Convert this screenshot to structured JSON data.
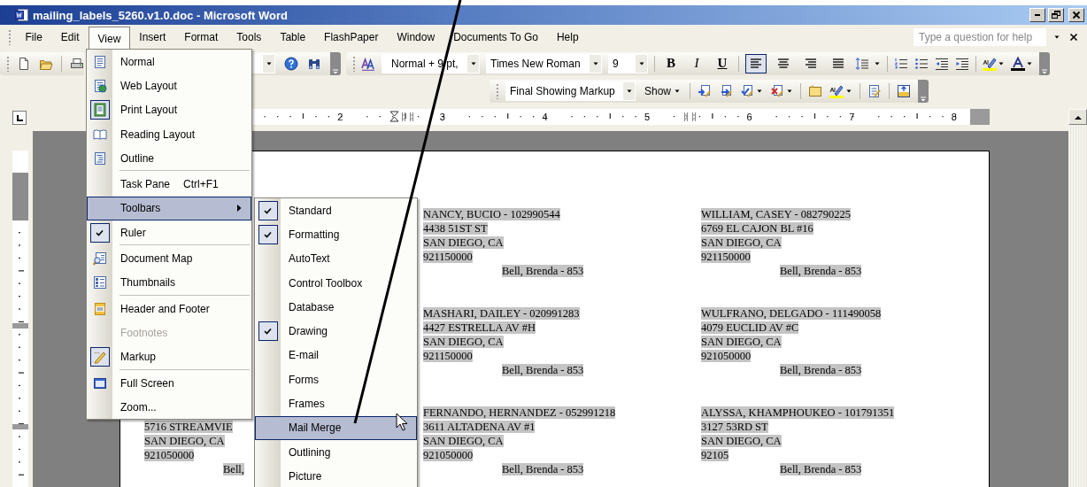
{
  "window": {
    "title": "mailing_labels_5260.v1.0.doc - Microsoft Word"
  },
  "menu_bar": {
    "items": [
      {
        "label": "File",
        "selected": false
      },
      {
        "label": "Edit",
        "selected": false
      },
      {
        "label": "View",
        "selected": true
      },
      {
        "label": "Insert",
        "selected": false
      },
      {
        "label": "Format",
        "selected": false
      },
      {
        "label": "Tools",
        "selected": false
      },
      {
        "label": "Table",
        "selected": false
      },
      {
        "label": "FlashPaper",
        "selected": false
      },
      {
        "label": "Window",
        "selected": false
      },
      {
        "label": "Documents To Go",
        "selected": false
      },
      {
        "label": "Help",
        "selected": false
      }
    ],
    "help_field": {
      "placeholder": "Type a question for help"
    }
  },
  "formatting_toolbar": {
    "style": "Normal + 9 pt,",
    "font": "Times New Roman",
    "size": "9",
    "text_style_buttons": [
      {
        "label": "B"
      },
      {
        "label": "I"
      },
      {
        "label": "U"
      }
    ],
    "alignment_buttons": [
      {
        "selected": true
      },
      {
        "selected": false
      },
      {
        "selected": false
      },
      {
        "selected": false
      }
    ]
  },
  "reviewing_toolbar": {
    "display": "Final Showing Markup",
    "show_button": "Show"
  },
  "ruler": {
    "numbers": [
      "2",
      "3",
      "4",
      "5",
      "6",
      "7",
      "8"
    ]
  },
  "view_menu": {
    "items": [
      {
        "label": "Normal",
        "checked": false,
        "selected": false,
        "disabled": false,
        "submenu": false,
        "separator_before": false
      },
      {
        "label": "Web Layout",
        "checked": false,
        "selected": false,
        "disabled": false,
        "submenu": false,
        "separator_before": false
      },
      {
        "label": "Print Layout",
        "checked": true,
        "selected": false,
        "disabled": false,
        "submenu": false,
        "separator_before": false
      },
      {
        "label": "Reading Layout",
        "checked": false,
        "selected": false,
        "disabled": false,
        "submenu": false,
        "separator_before": false
      },
      {
        "label": "Outline",
        "checked": false,
        "selected": false,
        "disabled": false,
        "submenu": false,
        "separator_before": false
      },
      {
        "label": "Task Pane",
        "shortcut": "Ctrl+F1",
        "checked": false,
        "selected": false,
        "disabled": false,
        "submenu": false,
        "separator_before": true
      },
      {
        "label": "Toolbars",
        "checked": false,
        "selected": true,
        "disabled": false,
        "submenu": true,
        "separator_before": false
      },
      {
        "label": "Ruler",
        "checked": true,
        "selected": false,
        "disabled": false,
        "submenu": false,
        "separator_before": false
      },
      {
        "label": "Document Map",
        "checked": false,
        "selected": false,
        "disabled": false,
        "submenu": false,
        "separator_before": true
      },
      {
        "label": "Thumbnails",
        "checked": false,
        "selected": false,
        "disabled": false,
        "submenu": false,
        "separator_before": false
      },
      {
        "label": "Header and Footer",
        "checked": false,
        "selected": false,
        "disabled": false,
        "submenu": false,
        "separator_before": true
      },
      {
        "label": "Footnotes",
        "checked": false,
        "selected": false,
        "disabled": true,
        "submenu": false,
        "separator_before": false
      },
      {
        "label": "Markup",
        "checked": true,
        "selected": false,
        "disabled": false,
        "submenu": false,
        "separator_before": false
      },
      {
        "label": "Full Screen",
        "checked": false,
        "selected": false,
        "disabled": false,
        "submenu": false,
        "separator_before": true
      },
      {
        "label": "Zoom...",
        "checked": false,
        "selected": false,
        "disabled": false,
        "submenu": false,
        "separator_before": false
      }
    ]
  },
  "toolbars_submenu": {
    "items": [
      {
        "label": "Standard",
        "checked": true,
        "selected": false
      },
      {
        "label": "Formatting",
        "checked": true,
        "selected": false
      },
      {
        "label": "AutoText",
        "checked": false,
        "selected": false
      },
      {
        "label": "Control Toolbox",
        "checked": false,
        "selected": false
      },
      {
        "label": "Database",
        "checked": false,
        "selected": false
      },
      {
        "label": "Drawing",
        "checked": true,
        "selected": false
      },
      {
        "label": "E-mail",
        "checked": false,
        "selected": false
      },
      {
        "label": "Forms",
        "checked": false,
        "selected": false
      },
      {
        "label": "Frames",
        "checked": false,
        "selected": false
      },
      {
        "label": "Mail Merge",
        "checked": false,
        "selected": true
      },
      {
        "label": "Outlining",
        "checked": false,
        "selected": false
      },
      {
        "label": "Picture",
        "checked": false,
        "selected": false
      }
    ]
  },
  "document": {
    "label_columns": [
      {
        "labels": [
          {
            "lines": [
              "5716 STREAMVIE",
              "SAN DIEGO, CA",
              "921050000"
            ],
            "footer": "Bell,"
          }
        ]
      },
      {
        "labels": [
          {
            "lines": [
              "NANCY, BUCIO - 102990544",
              "4438 51ST ST",
              "SAN DIEGO, CA",
              "921150000"
            ],
            "footer": "Bell, Brenda - 853"
          },
          {
            "lines": [
              "MASHARI, DAILEY - 020991283",
              "4427 ESTRELLA AV #H",
              "SAN DIEGO, CA",
              "921150000"
            ],
            "footer": "Bell, Brenda - 853"
          },
          {
            "lines": [
              "FERNANDO, HERNANDEZ - 052991218",
              "3611 ALTADENA AV #1",
              "SAN DIEGO, CA",
              "921050000"
            ],
            "footer": "Bell, Brenda - 853"
          }
        ]
      },
      {
        "labels": [
          {
            "lines": [
              "WILLIAM, CASEY - 082790225",
              "6769 EL CAJON BL #16",
              "SAN DIEGO, CA",
              "921150000"
            ],
            "footer": "Bell, Brenda - 853"
          },
          {
            "lines": [
              "WULFRANO, DELGADO - 111490058",
              "4079 EUCLID AV #C",
              "SAN DIEGO, CA",
              "921050000"
            ],
            "footer": "Bell, Brenda - 853"
          },
          {
            "lines": [
              "ALYSSA, KHAMPHOUKEO - 101791351",
              "3127 53RD ST",
              "SAN DIEGO, CA",
              "92105"
            ],
            "footer": "Bell, Brenda - 853"
          }
        ]
      }
    ]
  }
}
